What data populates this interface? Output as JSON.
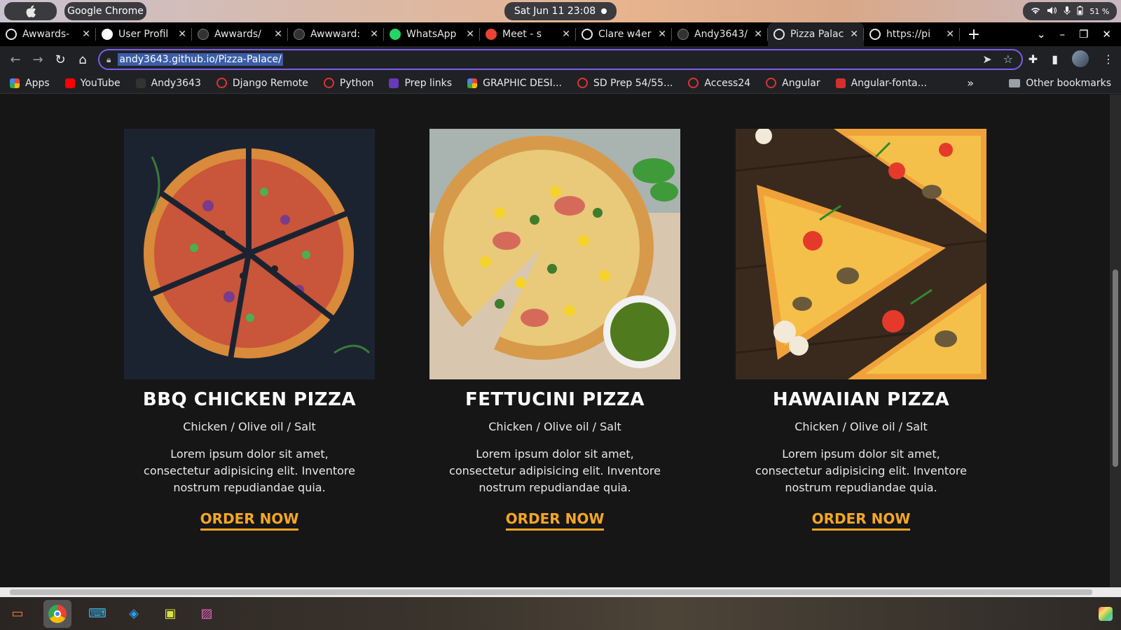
{
  "system_bar": {
    "apple_label": "",
    "app_name": "Google Chrome",
    "clock": "Sat Jun 11  23:08",
    "battery": "51 %"
  },
  "tabs": [
    {
      "label": "Awwards-",
      "icon": "globe-icon",
      "color": "#ffffff"
    },
    {
      "label": "User Profil",
      "icon": "laptop-icon",
      "color": "#ffffff"
    },
    {
      "label": "Awwards/",
      "icon": "github-icon",
      "color": "#333333"
    },
    {
      "label": "Awwward:",
      "icon": "github-icon",
      "color": "#333333"
    },
    {
      "label": "WhatsApp",
      "icon": "whatsapp-icon",
      "color": "#25d366"
    },
    {
      "label": "Meet - s",
      "icon": "meet-icon",
      "color": "#ea4335"
    },
    {
      "label": "Clare w4er",
      "icon": "globe-icon",
      "color": "#ffffff"
    },
    {
      "label": "Andy3643/",
      "icon": "github-icon",
      "color": "#333333"
    },
    {
      "label": "Pizza Palac",
      "icon": "globe-icon",
      "color": "#ffffff",
      "active": true
    },
    {
      "label": "https://pi",
      "icon": "globe-icon",
      "color": "#ffffff"
    }
  ],
  "address_bar": {
    "url": "andy3643.github.io/Pizza-Palace/"
  },
  "bookmarks": [
    {
      "label": "Apps",
      "icon": "apps-grid-icon"
    },
    {
      "label": "YouTube",
      "icon": "youtube-icon"
    },
    {
      "label": "Andy3643",
      "icon": "github-icon"
    },
    {
      "label": "Django Remote",
      "icon": "ring-icon"
    },
    {
      "label": "Python",
      "icon": "ring-icon"
    },
    {
      "label": "Prep links",
      "icon": "forms-icon"
    },
    {
      "label": "GRAPHIC DESI...",
      "icon": "pinwheel-icon"
    },
    {
      "label": "SD Prep 54/55...",
      "icon": "ring-icon"
    },
    {
      "label": "Access24",
      "icon": "ring-icon"
    },
    {
      "label": "Angular",
      "icon": "ring-icon"
    },
    {
      "label": "Angular-fonta...",
      "icon": "fontawesome-icon"
    }
  ],
  "bookmarks_more": "»",
  "other_bookmarks": "Other bookmarks",
  "pizzas": [
    {
      "name": "BBQ CHICKEN PIZZA",
      "ingredients": "Chicken / Olive oil / Salt",
      "description": "Lorem ipsum dolor sit amet, consectetur adipisicing elit. Inventore nostrum repudiandae quia.",
      "cta": "ORDER NOW"
    },
    {
      "name": "FETTUCINI PIZZA",
      "ingredients": "Chicken / Olive oil / Salt",
      "description": "Lorem ipsum dolor sit amet, consectetur adipisicing elit. Inventore nostrum repudiandae quia.",
      "cta": "ORDER NOW"
    },
    {
      "name": "HAWAIIAN PIZZA",
      "ingredients": "Chicken / Olive oil / Salt",
      "description": "Lorem ipsum dolor sit amet, consectetur adipisicing elit. Inventore nostrum repudiandae quia.",
      "cta": "ORDER NOW"
    }
  ],
  "colors": {
    "accent": "#f5a623",
    "page_bg": "#161616",
    "omnibox_focus": "#7b5cf0"
  }
}
